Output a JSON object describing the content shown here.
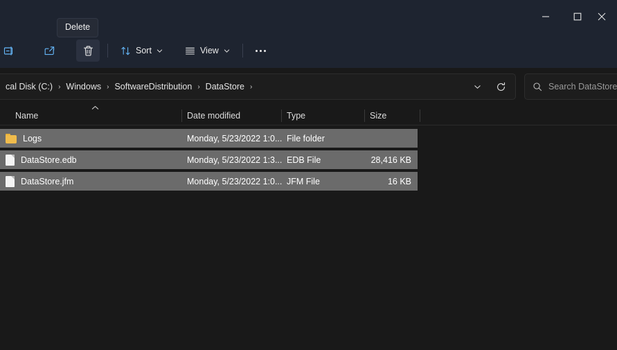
{
  "window": {
    "controls": [
      {
        "name": "minimize",
        "label": "–"
      },
      {
        "name": "maximize",
        "label": "□"
      },
      {
        "name": "close",
        "label": "×"
      }
    ]
  },
  "tooltip": {
    "text": "Delete"
  },
  "toolbar": {
    "rename_icon": "rename-icon",
    "share_icon": "share-icon",
    "delete_icon": "delete-trash-icon",
    "sort_label": "Sort",
    "sort_icon": "sort-arrows-icon",
    "view_label": "View",
    "view_icon": "view-list-icon",
    "more_label": "See more",
    "more_icon": "ellipsis-icon"
  },
  "address": {
    "crumbs": [
      "cal Disk  (C:)",
      "Windows",
      "SoftwareDistribution",
      "DataStore"
    ],
    "separator": "›",
    "dropdown_icon": "chevron-down-icon",
    "refresh_icon": "refresh-icon"
  },
  "search": {
    "placeholder": "Search DataStore",
    "icon": "search-icon"
  },
  "columns": {
    "name": "Name",
    "date_modified": "Date modified",
    "type": "Type",
    "size": "Size",
    "sort_indicator": "˄"
  },
  "files": [
    {
      "name": "Logs",
      "date": "Monday, 5/23/2022 1:0...",
      "type": "File folder",
      "size": "",
      "icon": "folder-icon",
      "selected": true
    },
    {
      "name": "DataStore.edb",
      "date": "Monday, 5/23/2022 1:3...",
      "type": "EDB File",
      "size": "28,416 KB",
      "icon": "file-icon",
      "selected": true
    },
    {
      "name": "DataStore.jfm",
      "date": "Monday, 5/23/2022 1:0...",
      "type": "JFM File",
      "size": "16 KB",
      "icon": "file-icon",
      "selected": true
    }
  ],
  "colors": {
    "titlebar": "#1e2430",
    "content_bg": "#191919",
    "selection": "#6b6b6b",
    "accent_icon": "#64b5f6",
    "folder": "#f0bc4c"
  }
}
